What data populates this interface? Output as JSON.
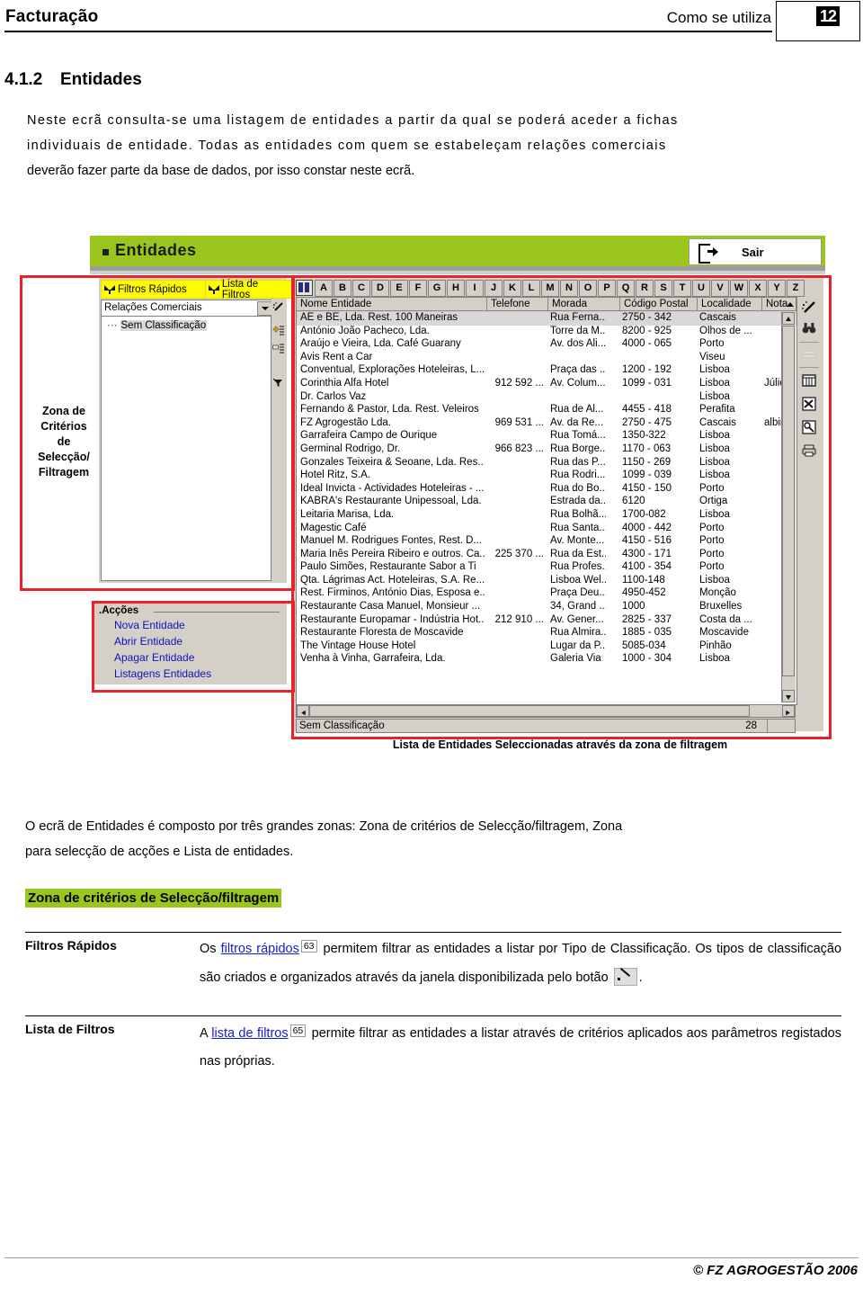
{
  "header": {
    "left_title": "Facturação",
    "right_title": "Como se utiliza",
    "page_number": "12"
  },
  "section": {
    "number": "4.1.2",
    "title": "Entidades",
    "intro_1": "Neste ecrã  consulta-se uma  listagem de  entidades a  partir da  qual se  poderá  aceder a  fichas",
    "intro_2": "individuais de   entidade.  Todas as   entidades  com  quem se   estabeleçam  relações  comerciais",
    "intro_3": "deverão fazer parte da base de  dados, por  isso  constar  neste  ecrã."
  },
  "screenshot": {
    "window_title": "Entidades",
    "exit_button": "Sair",
    "left_zone_label": "Zona de\nCritérios\nde\nSelecção/\nFiltragem",
    "left_zone_label_lines": [
      "Zona de",
      "Critérios",
      "de",
      "Selecção/",
      "Filtragem"
    ],
    "tabs": [
      {
        "label": "Filtros Rápidos",
        "icon": "funnel-icon"
      },
      {
        "label": "Lista de Filtros",
        "icon": "funnel-icon"
      }
    ],
    "combo_value": "Relações Comerciais",
    "tree_item": "Sem Classificação",
    "left_tools": [
      "magic-wand-icon",
      "add-list-icon",
      "edit-list-icon",
      "clear-filter-icon"
    ],
    "actions_panel": {
      "title": ".Acções",
      "links": [
        "Nova Entidade",
        "Abrir Entidade",
        "Apagar Entidade",
        "Listagens Entidades"
      ]
    },
    "alphabet": [
      "A",
      "B",
      "C",
      "D",
      "E",
      "F",
      "G",
      "H",
      "I",
      "J",
      "K",
      "L",
      "M",
      "N",
      "O",
      "P",
      "Q",
      "R",
      "S",
      "T",
      "U",
      "V",
      "W",
      "X",
      "Y",
      "Z"
    ],
    "alphabet_icon": "address-book-icon",
    "grid": {
      "columns": [
        "Nome Entidade",
        "Telefone",
        "Morada",
        "Código Postal",
        "Localidade",
        "Nota"
      ],
      "rows": [
        {
          "nome": "AE e BE, Lda. Rest. 100 Maneiras",
          "telefone": "",
          "morada": "Rua Ferna...",
          "cp": "2750 - 342",
          "localidade": "Cascais",
          "nota": "",
          "selected": true
        },
        {
          "nome": "António João Pacheco, Lda.",
          "telefone": "",
          "morada": "Torre da M...",
          "cp": "8200 - 925",
          "localidade": "Olhos de ...",
          "nota": ""
        },
        {
          "nome": "Araújo e Vieira, Lda. Café Guarany",
          "telefone": "",
          "morada": "Av. dos Ali...",
          "cp": "4000 - 065",
          "localidade": "Porto",
          "nota": ""
        },
        {
          "nome": "Avis Rent a Car",
          "telefone": "",
          "morada": "",
          "cp": "",
          "localidade": "Viseu",
          "nota": ""
        },
        {
          "nome": "Conventual, Explorações Hoteleiras, L...",
          "telefone": "",
          "morada": "Praça das ...",
          "cp": "1200 - 192",
          "localidade": "Lisboa",
          "nota": ""
        },
        {
          "nome": "Corinthia Alfa Hotel",
          "telefone": "912 592 ...",
          "morada": "Av. Colum...",
          "cp": "1099 - 031",
          "localidade": "Lisboa",
          "nota": "Júlio"
        },
        {
          "nome": "Dr. Carlos Vaz",
          "telefone": "",
          "morada": "",
          "cp": "",
          "localidade": "Lisboa",
          "nota": ""
        },
        {
          "nome": "Fernando & Pastor, Lda. Rest. Veleiros",
          "telefone": "",
          "morada": "Rua de  Al...",
          "cp": "4455 - 418",
          "localidade": "Perafita",
          "nota": ""
        },
        {
          "nome": "FZ Agrogestão Lda.",
          "telefone": "969 531 ...",
          "morada": "Av. da Re...",
          "cp": "2750 - 475",
          "localidade": "Cascais",
          "nota": "albin"
        },
        {
          "nome": "Garrafeira Campo de Ourique",
          "telefone": "",
          "morada": "Rua Tomá...",
          "cp": "1350-322",
          "localidade": "Lisboa",
          "nota": ""
        },
        {
          "nome": "Germinal Rodrigo, Dr.",
          "telefone": "966 823 ...",
          "morada": "Rua Borge...",
          "cp": "1170 - 063",
          "localidade": "Lisboa",
          "nota": ""
        },
        {
          "nome": "Gonzales Teixeira & Seoane, Lda. Res...",
          "telefone": "",
          "morada": "Rua das P...",
          "cp": "1150 - 269",
          "localidade": "Lisboa",
          "nota": ""
        },
        {
          "nome": "Hotel Ritz, S.A.",
          "telefone": "",
          "morada": "Rua Rodri...",
          "cp": "1099 - 039",
          "localidade": "Lisboa",
          "nota": ""
        },
        {
          "nome": "Ideal Invicta - Actividades Hoteleiras - ...",
          "telefone": "",
          "morada": "Rua do Bo...",
          "cp": "4150 - 150",
          "localidade": "Porto",
          "nota": ""
        },
        {
          "nome": "KABRA's Restaurante Unipessoal, Lda.",
          "telefone": "",
          "morada": "Estrada da...",
          "cp": "6120",
          "localidade": "Ortiga",
          "nota": ""
        },
        {
          "nome": "Leitaria Marisa, Lda.",
          "telefone": "",
          "morada": "Rua Bolhã...",
          "cp": "1700-082",
          "localidade": "Lisboa",
          "nota": ""
        },
        {
          "nome": "Magestic Café",
          "telefone": "",
          "morada": "Rua Santa...",
          "cp": "4000 - 442",
          "localidade": "Porto",
          "nota": ""
        },
        {
          "nome": "Manuel M. Rodrigues Fontes, Rest. D...",
          "telefone": "",
          "morada": "Av. Monte...",
          "cp": "4150 - 516",
          "localidade": "Porto",
          "nota": ""
        },
        {
          "nome": "Maria Inês Pereira Ribeiro e outros. Ca...",
          "telefone": "225 370 ...",
          "morada": "Rua da Est...",
          "cp": "4300 - 171",
          "localidade": "Porto",
          "nota": ""
        },
        {
          "nome": "Paulo Simões, Restaurante Sabor a Ti",
          "telefone": "",
          "morada": "Rua Profes...",
          "cp": "4100 - 354",
          "localidade": "Porto",
          "nota": ""
        },
        {
          "nome": "Qta. Lágrimas Act. Hoteleiras, S.A. Re...",
          "telefone": "",
          "morada": "Lisboa Wel...",
          "cp": "1100-148",
          "localidade": "Lisboa",
          "nota": ""
        },
        {
          "nome": "Rest. Firminos, António Dias, Esposa e...",
          "telefone": "",
          "morada": "Praça Deu...",
          "cp": "4950-452",
          "localidade": "Monção",
          "nota": ""
        },
        {
          "nome": "Restaurante Casa Manuel, Monsieur ...",
          "telefone": "",
          "morada": "34, Grand ...",
          "cp": "1000",
          "localidade": "Bruxelles",
          "nota": ""
        },
        {
          "nome": "Restaurante Europamar - Indústria Hot...",
          "telefone": "212 910 ...",
          "morada": "Av. Gener...",
          "cp": "2825 - 337",
          "localidade": "Costa da ...",
          "nota": ""
        },
        {
          "nome": "Restaurante Floresta de Moscavide",
          "telefone": "",
          "morada": "Rua Almira...",
          "cp": "1885 - 035",
          "localidade": "Moscavide",
          "nota": ""
        },
        {
          "nome": "The Vintage House Hotel",
          "telefone": "",
          "morada": "Lugar da P...",
          "cp": "5085-034",
          "localidade": "Pinhão",
          "nota": ""
        },
        {
          "nome": "Venha à Vinha, Garrafeira, Lda.",
          "telefone": "",
          "morada": "Galeria Via",
          "cp": "1000 - 304",
          "localidade": "Lisboa",
          "nota": ""
        }
      ]
    },
    "status_left": "Sem Classificação",
    "status_right": "28",
    "right_tools": [
      "magic-wand-icon",
      "binoculars-icon",
      "lines-icon",
      "grid-icon",
      "excel-icon",
      "preview-icon",
      "printer-icon"
    ],
    "caption": "Lista de Entidades Seleccionadas através da zona de filtragem"
  },
  "body": {
    "para_line1": "O  ecrã de   Entidades é   composto  por  três   grandes   zonas: Zona de critérios de Selecção/filtragem, Zona",
    "para_line2": "para selecção de acções  e  Lista de entidades.",
    "green_heading": "Zona de critérios de Selecção/filtragem",
    "definitions": [
      {
        "term": "Filtros Rápidos",
        "pre": "Os ",
        "link": "filtros rápidos",
        "ref": "63",
        "post": " permitem filtrar as entidades a listar por Tipo de Classificação. Os tipos de classificação são criados e organizados através da janela disponibilizada pelo botão ",
        "tail": "."
      },
      {
        "term": "Lista de Filtros",
        "pre": "A ",
        "link": "lista de filtros",
        "ref": "65",
        "post": " permite filtrar as entidades a listar através de critérios aplicados aos parâmetros registados nas próprias.",
        "tail": ""
      }
    ]
  },
  "footer": {
    "copyright": "© FZ AGROGESTÃO 2006"
  }
}
